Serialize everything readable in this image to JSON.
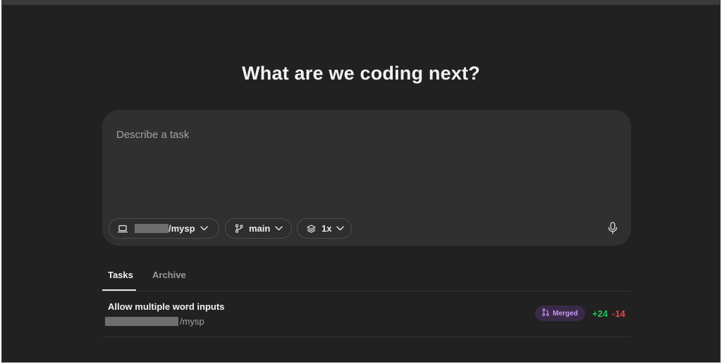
{
  "headline": "What are we coding next?",
  "composer": {
    "placeholder": "Describe a task",
    "repo_label": "/mysp",
    "branch_label": "main",
    "count_label": "1x"
  },
  "tabs": [
    {
      "label": "Tasks",
      "active": true
    },
    {
      "label": "Archive",
      "active": false
    }
  ],
  "tasks": [
    {
      "title": "Allow multiple word inputs",
      "repo": "/mysp",
      "status": "Merged",
      "additions": "+24",
      "deletions": "-14"
    }
  ],
  "colors": {
    "background": "#212121",
    "composer": "#303030",
    "merged_badge_bg": "#3a2a48",
    "merged_badge_text": "#c79bf2",
    "additions": "#22c55e",
    "deletions": "#ef4444"
  },
  "icons": {
    "repo": "laptop-icon",
    "branch": "git-branch-icon",
    "count": "layers-icon",
    "mic": "microphone-icon",
    "merged": "git-merge-icon"
  }
}
